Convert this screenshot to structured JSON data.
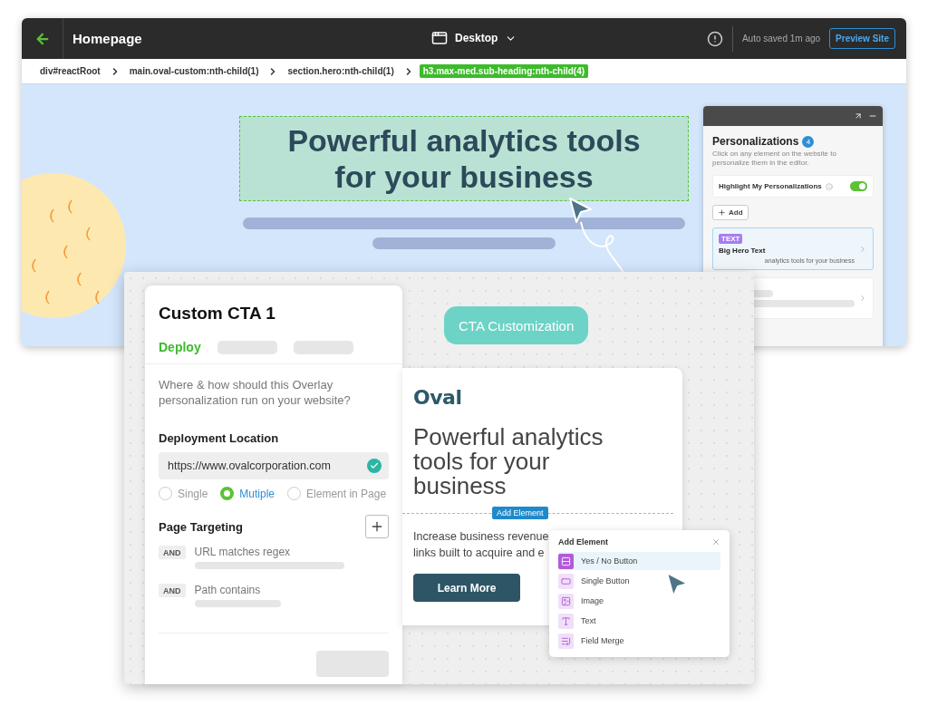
{
  "topbar": {
    "page_title": "Homepage",
    "device": "Desktop",
    "autosave": "Auto saved 1m ago",
    "preview_button": "Preview Site"
  },
  "breadcrumb": [
    {
      "label": "div#reactRoot",
      "selected": false
    },
    {
      "label": "main.oval-custom:nth-child(1)",
      "selected": false
    },
    {
      "label": "section.hero:nth-child(1)",
      "selected": false
    },
    {
      "label": "h3.max-med.sub-heading:nth-child(4)",
      "selected": true
    }
  ],
  "hero": {
    "heading_lines": [
      "Powerful analytics tools",
      "for your business"
    ],
    "selected": true
  },
  "personalizations": {
    "title": "Personalizations",
    "count": "4",
    "hint": "Click on any element on the website to personalize them in the editor.",
    "highlight": {
      "label": "Highlight My Personalizations",
      "on": true
    },
    "add_button": "Add",
    "items": [
      {
        "tag": "TEXT",
        "title": "Big Hero Text",
        "subtitle": "analytics tools for your business",
        "selected": true
      }
    ]
  },
  "cta_card": {
    "title": "Custom CTA 1",
    "tab": "Deploy",
    "question": "Where & how should this Overlay personalization run on your website?",
    "location_label": "Deployment Location",
    "url": "https://www.ovalcorporation.com",
    "url_valid": true,
    "modes": [
      {
        "label": "Single",
        "selected": false
      },
      {
        "label": "Mutiple",
        "selected": true
      },
      {
        "label": "Element in Page",
        "selected": false
      }
    ],
    "targeting_label": "Page Targeting",
    "rules": [
      {
        "operator": "AND",
        "label": "URL matches regex"
      },
      {
        "operator": "AND",
        "label": "Path contains"
      }
    ]
  },
  "badge": "CTA Customization",
  "preview": {
    "logo": "Oval",
    "heading": "Powerful analytics tools for your business",
    "add_element_tag": "Add Element",
    "body_lines": [
      "Increase business revenue",
      "links built to acquire and e"
    ],
    "button": "Learn More"
  },
  "add_menu": {
    "title": "Add Element",
    "items": [
      {
        "label": "Yes / No Button",
        "kind": "yesno",
        "selected": true
      },
      {
        "label": "Single Button",
        "kind": "button",
        "selected": false
      },
      {
        "label": "Image",
        "kind": "image",
        "selected": false
      },
      {
        "label": "Text",
        "kind": "text",
        "selected": false
      },
      {
        "label": "Field Merge",
        "kind": "merge",
        "selected": false
      }
    ]
  }
}
